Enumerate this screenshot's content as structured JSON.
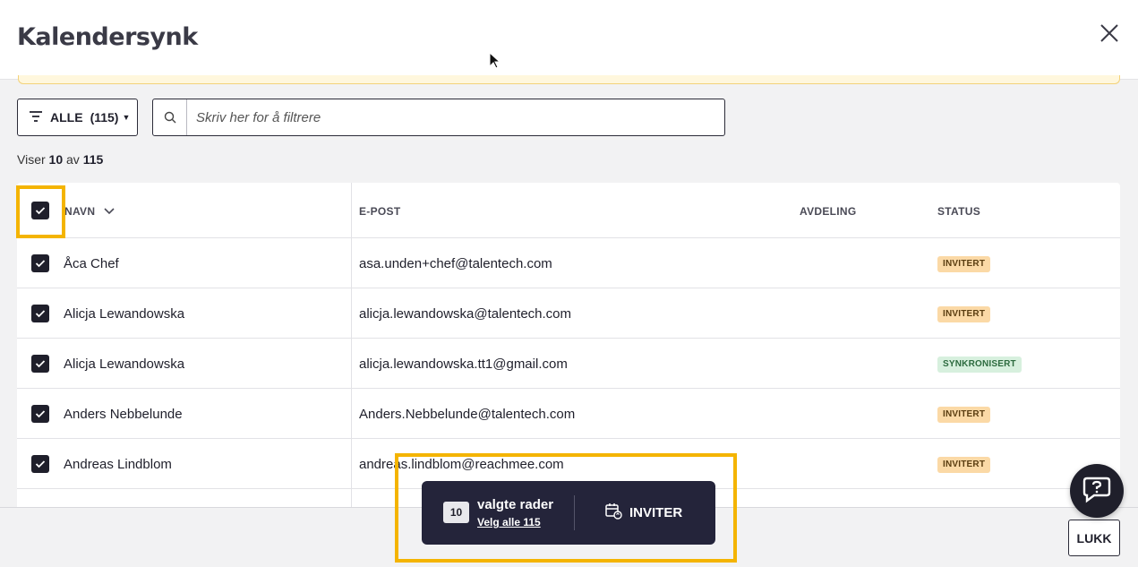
{
  "dialog": {
    "title": "Kalendersynk"
  },
  "toolbar": {
    "filter_label": "ALLE",
    "filter_count": "(115)",
    "search_placeholder": "Skriv her for å filtrere"
  },
  "summary": {
    "prefix": "Viser",
    "shown": "10",
    "middle": "av",
    "total": "115"
  },
  "table": {
    "columns": {
      "name": "NAVN",
      "email": "E-POST",
      "department": "AVDELING",
      "status": "STATUS"
    },
    "rows": [
      {
        "name": "Åca Chef",
        "email": "asa.unden+chef@talentech.com",
        "department": "",
        "status": "INVITERT",
        "status_kind": "invited"
      },
      {
        "name": "Alicja Lewandowska",
        "email": "alicja.lewandowska@talentech.com",
        "department": "",
        "status": "INVITERT",
        "status_kind": "invited"
      },
      {
        "name": "Alicja Lewandowska",
        "email": "alicja.lewandowska.tt1@gmail.com",
        "department": "",
        "status": "SYNKRONISERT",
        "status_kind": "synced"
      },
      {
        "name": "Anders Nebbelunde",
        "email": "Anders.Nebbelunde@talentech.com",
        "department": "",
        "status": "INVITERT",
        "status_kind": "invited"
      },
      {
        "name": "Andreas Lindblom",
        "email": "andreas.lindblom@reachmee.com",
        "department": "",
        "status": "INVITERT",
        "status_kind": "invited"
      }
    ]
  },
  "action_bar": {
    "selected_count": "10",
    "selected_label": "valgte rader",
    "select_all_label": "Velg alle 115",
    "invite_label": "INVITER"
  },
  "footer": {
    "close_label": "LUKK"
  },
  "colors": {
    "highlight": "#f4b400",
    "invited_badge": "#fbd9a6",
    "synced_badge": "#d7f0de",
    "dark": "#24243a"
  },
  "icons": [
    "close-icon",
    "filter-icon",
    "search-icon",
    "checkbox-checked-icon",
    "chevron-down-icon",
    "calendar-sync-icon",
    "chat-help-icon",
    "mouse-cursor-icon"
  ]
}
